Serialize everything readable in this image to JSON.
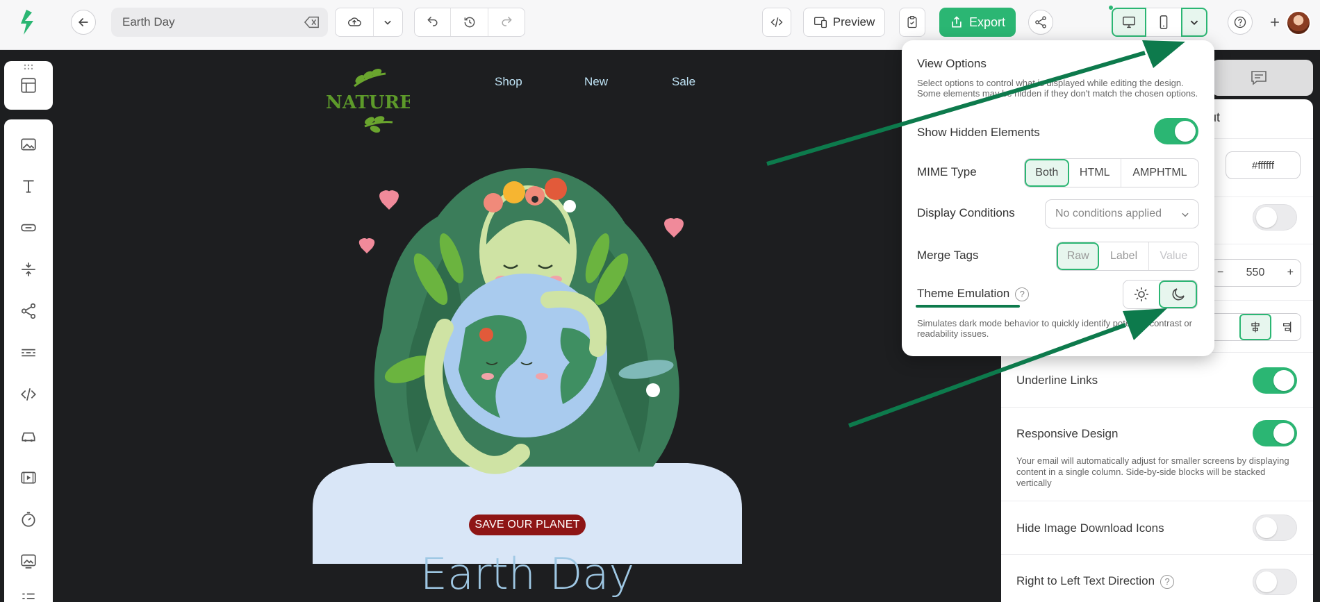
{
  "toolbar": {
    "title_value": "Earth Day",
    "preview_label": "Preview",
    "export_label": "Export"
  },
  "email": {
    "nav": [
      "Shop",
      "New",
      "Sale"
    ],
    "logo_text": "NATURE",
    "badge": "SAVE OUR PLANET",
    "heading": "Earth Day"
  },
  "view_options": {
    "title": "View Options",
    "description": "Select options to control what is displayed while editing the design. Some elements may be hidden if they don't match the chosen options.",
    "show_hidden_label": "Show Hidden Elements",
    "show_hidden_on": true,
    "mime_label": "MIME Type",
    "mime_options": [
      "Both",
      "HTML",
      "AMPHTML"
    ],
    "mime_selected": "Both",
    "display_conditions_label": "Display Conditions",
    "display_conditions_value": "No conditions applied",
    "merge_tags_label": "Merge Tags",
    "merge_tags_options": [
      "Raw",
      "Label",
      "Value"
    ],
    "merge_tags_selected": "Raw",
    "theme_label": "Theme Emulation",
    "theme_selected": "dark",
    "theme_description": "Simulates dark mode behavior to quickly identify potential contrast or readability issues."
  },
  "properties": {
    "heading_fragment": "ut",
    "background_color": "#ffffff",
    "content_width": "550",
    "underline_links_label": "Underline Links",
    "underline_links_on": true,
    "responsive_label": "Responsive Design",
    "responsive_on": true,
    "responsive_description": "Your email will automatically adjust for smaller screens by displaying content in a single column. Side-by-side blocks will be stacked vertically",
    "hide_download_label": "Hide Image Download Icons",
    "hide_download_on": false,
    "rtl_label": "Right to Left Text Direction",
    "rtl_on": false
  },
  "colors": {
    "accent": "#2bb673",
    "arrow": "#0d7a4c",
    "canvas": "#1d1e20",
    "badge": "#8e1515",
    "heading": "#9fc8e4"
  }
}
